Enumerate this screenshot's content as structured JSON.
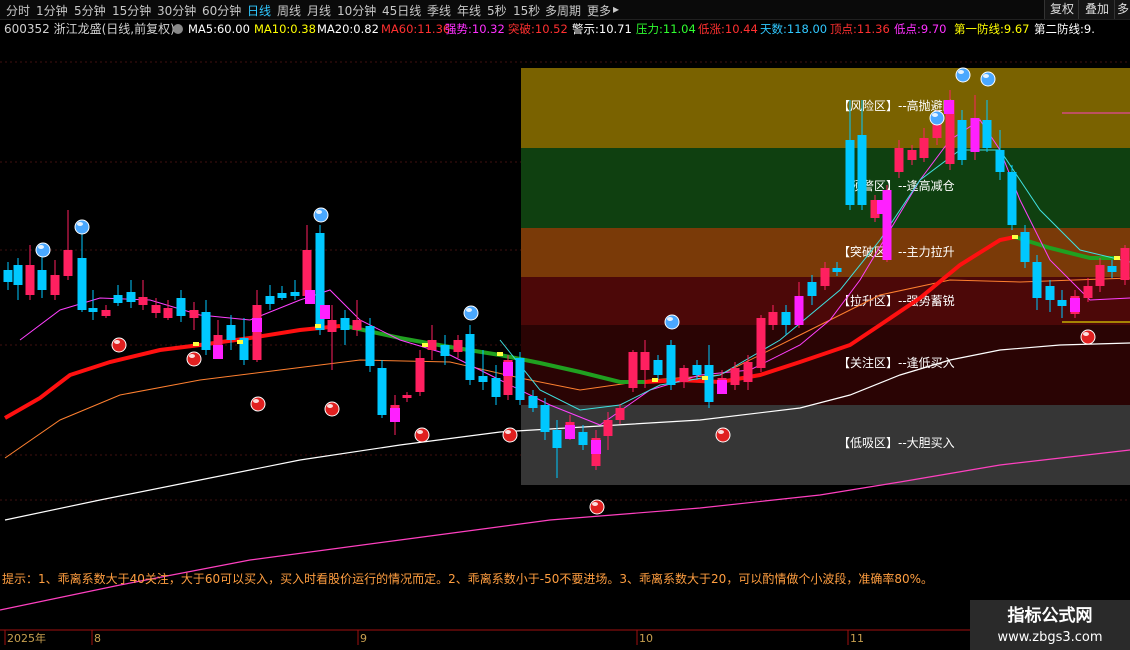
{
  "toolbar": {
    "periods": [
      "分时",
      "1分钟",
      "5分钟",
      "15分钟",
      "30分钟",
      "60分钟",
      "日线",
      "周线",
      "月线",
      "10分钟",
      "45日线",
      "季线",
      "年线",
      "5秒",
      "15秒",
      "多周期",
      "更多"
    ],
    "active_period": "日线",
    "more_arrow": "▸",
    "right_buttons": [
      "复权",
      "叠加",
      "多"
    ]
  },
  "info_bar": {
    "stock": "600352 浙江龙盛(日线,前复权)",
    "indicators": [
      {
        "label": "MA5:",
        "value": "60.00",
        "color": "#ffffff"
      },
      {
        "label": "MA10:",
        "value": "0.38",
        "color": "#ffff00"
      },
      {
        "label": "MA20:",
        "value": "0.82",
        "color": "#ffffff"
      },
      {
        "label": "MA60:",
        "value": "11.36",
        "color": "#ff3030"
      },
      {
        "label": "强势:",
        "value": "10.32",
        "color": "#ff30ff"
      },
      {
        "label": "突破:",
        "value": "10.52",
        "color": "#ff3030"
      },
      {
        "label": "警示:",
        "value": "10.71",
        "color": "#ffffff"
      },
      {
        "label": "压力:",
        "value": "11.04",
        "color": "#30ff30"
      },
      {
        "label": "低涨:",
        "value": "10.44",
        "color": "#ff3030"
      },
      {
        "label": "天数:",
        "value": "118.00",
        "color": "#30c8ff"
      },
      {
        "label": "顶点:",
        "value": "11.36",
        "color": "#ff3030"
      },
      {
        "label": "低点:",
        "value": "9.70",
        "color": "#ff30ff"
      },
      {
        "label": "第一防线:",
        "value": "9.67",
        "color": "#ffff00"
      },
      {
        "label": "第二防线:",
        "value": "9.",
        "color": "#ffffff"
      }
    ]
  },
  "zones": [
    {
      "label": "【风险区】--高抛避险",
      "color": "#7a6200"
    },
    {
      "label": "【预警区】--逢高减仓",
      "color": "#0f4010"
    },
    {
      "label": "【突破区】--主力拉升",
      "color": "#7a3a08"
    },
    {
      "label": "【拉升区】--强势蓄锐",
      "color": "#4c0808"
    },
    {
      "label": "【关注区】--逢低买入",
      "color": "#2a0404"
    },
    {
      "label": "【低吸区】--大胆买入",
      "color": "#363636"
    }
  ],
  "tip": "提示：1、乖离系数大于40关注，大于60可以买入，买入时看股价运行的情况而定。2、乖离系数小于-50不要进场。3、乖离系数大于20，可以酌情做个小波段，准确率80%。",
  "date_axis": [
    "2025年",
    "8",
    "9",
    "10",
    "11"
  ],
  "watermark": {
    "title": "指标公式网",
    "url": "www.zbgs3.com"
  },
  "colors": {
    "up": "#ff2060",
    "down": "#00c8ff",
    "ma_white": "#ffffff",
    "ma_red": "#ff1010",
    "ma_orange": "#ff8030",
    "ma_pink": "#ff40c0",
    "ma_green": "#20a020"
  }
}
